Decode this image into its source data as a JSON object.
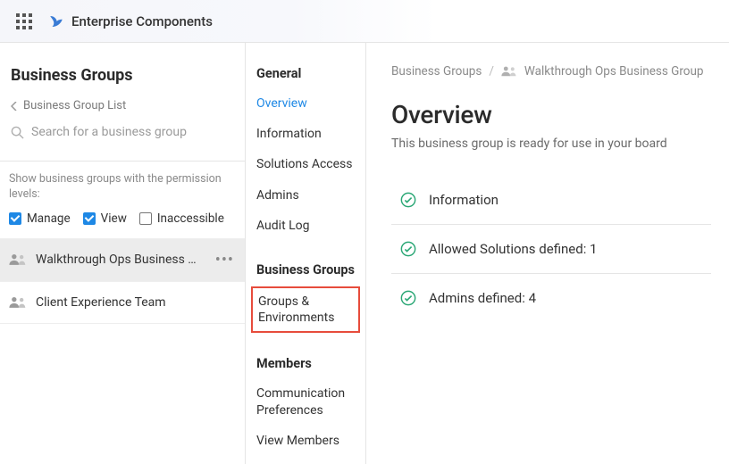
{
  "header": {
    "title": "Enterprise Components"
  },
  "leftcol": {
    "title": "Business Groups",
    "back_label": "Business Group List",
    "search_placeholder": "Search for a business group",
    "filter_label": "Show business groups with the permission levels:",
    "filters": {
      "manage": {
        "label": "Manage",
        "checked": true
      },
      "view": {
        "label": "View",
        "checked": true
      },
      "inaccessible": {
        "label": "Inaccessible",
        "checked": false
      }
    },
    "groups": [
      {
        "label": "Walkthrough Ops Business …",
        "active": true
      },
      {
        "label": "Client Experience Team",
        "active": false
      }
    ]
  },
  "midnav": {
    "sections": [
      {
        "heading": "General",
        "items": [
          {
            "label": "Overview",
            "active": true
          },
          {
            "label": "Information"
          },
          {
            "label": "Solutions Access"
          },
          {
            "label": "Admins"
          },
          {
            "label": "Audit Log"
          }
        ]
      },
      {
        "heading": "Business Groups",
        "items": [
          {
            "label": "Groups & Environments",
            "boxed": true
          }
        ]
      },
      {
        "heading": "Members",
        "items": [
          {
            "label": "Communication Preferences"
          },
          {
            "label": "View Members"
          }
        ]
      }
    ]
  },
  "main": {
    "breadcrumbs": {
      "root": "Business Groups",
      "current": "Walkthrough Ops Business Group"
    },
    "h1": "Overview",
    "subtext": "This business group is ready for use in your board",
    "rows": [
      {
        "label": "Information"
      },
      {
        "label": "Allowed Solutions defined: 1"
      },
      {
        "label": "Admins defined: 4"
      }
    ]
  }
}
